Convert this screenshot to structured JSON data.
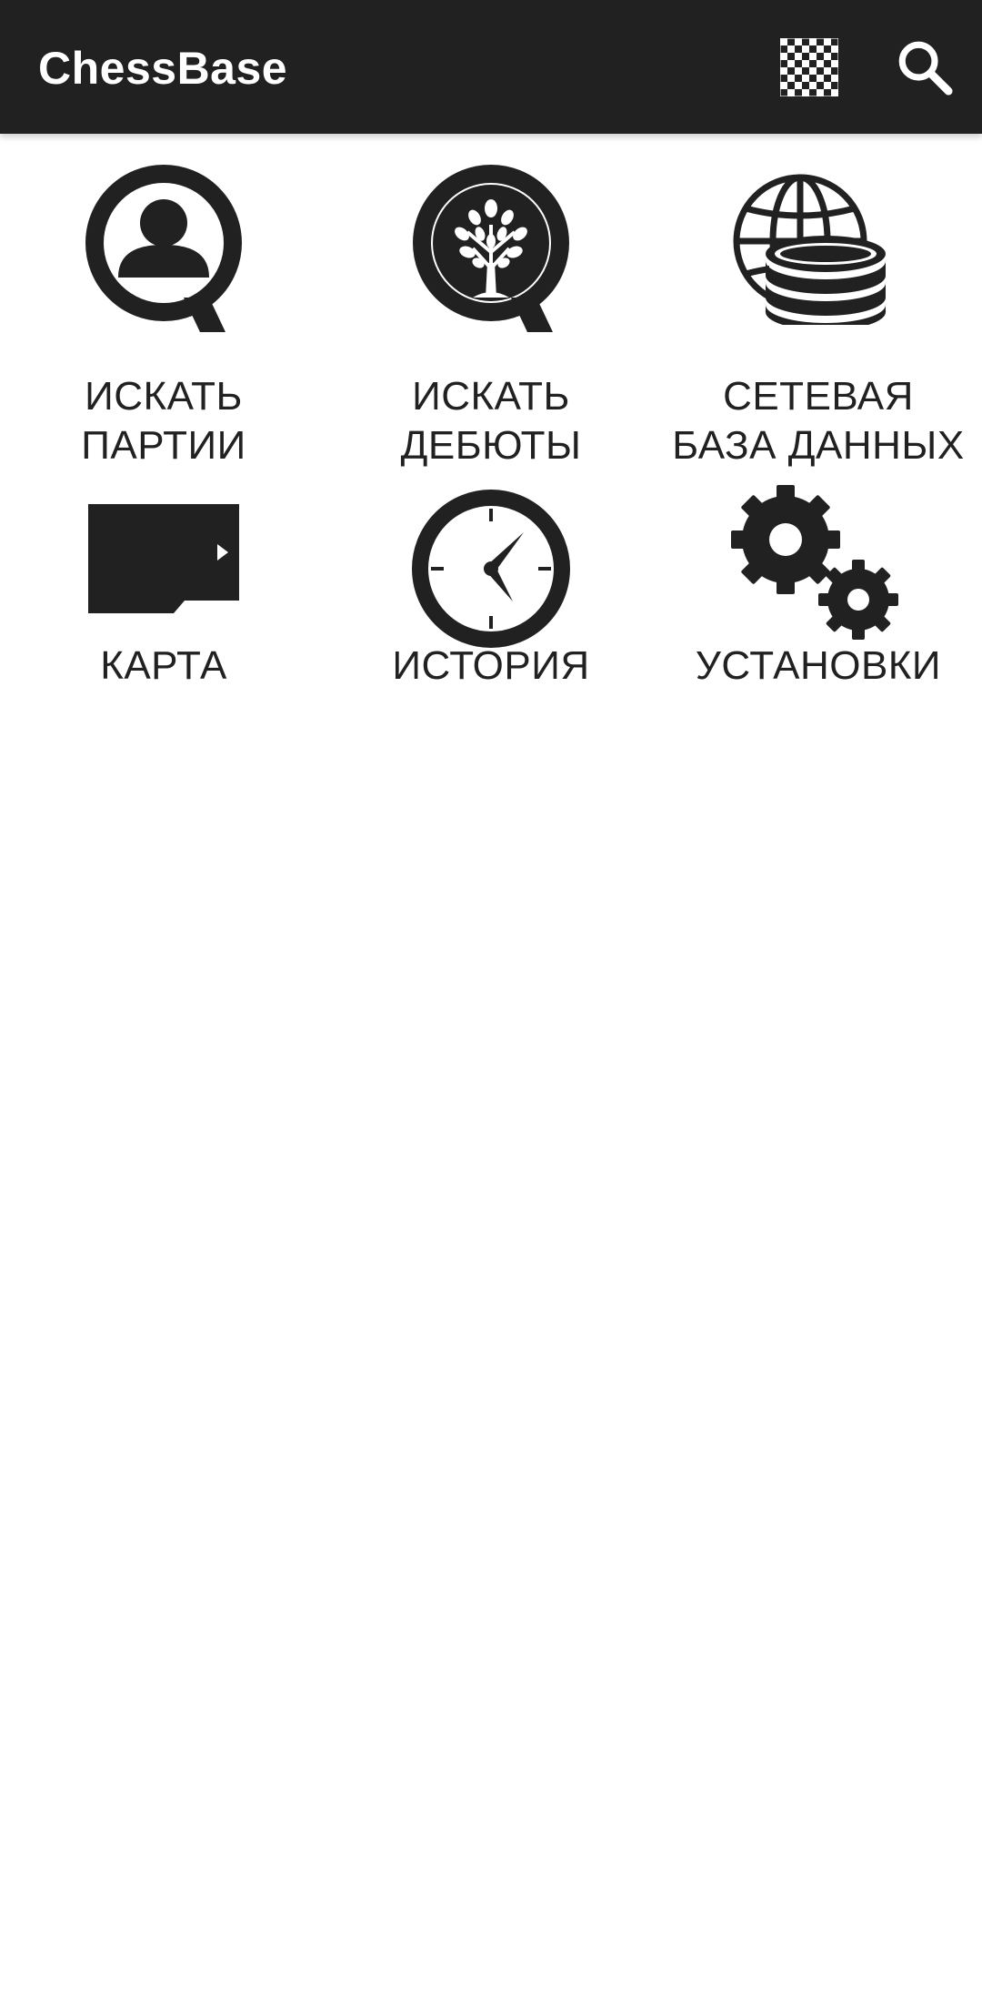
{
  "app_bar": {
    "title": "ChessBase",
    "actions": [
      {
        "name": "board",
        "icon": "chessboard-icon"
      },
      {
        "name": "search",
        "icon": "search-icon"
      }
    ]
  },
  "menu": {
    "items": [
      {
        "label": "ИСКАТЬ\nПАРТИИ",
        "icon": "search-games-icon"
      },
      {
        "label": "ИСКАТЬ\nДЕБЮТЫ",
        "icon": "search-openings-icon"
      },
      {
        "label": "СЕТЕВАЯ\nБАЗА ДАННЫХ",
        "icon": "online-database-icon"
      },
      {
        "label": "КАРТА",
        "icon": "sd-card-icon"
      },
      {
        "label": "ИСТОРИЯ",
        "icon": "clock-icon"
      },
      {
        "label": "УСТАНОВКИ",
        "icon": "gears-icon"
      }
    ]
  },
  "colors": {
    "app_bar": "#212121",
    "icon": "#212121",
    "background": "#ffffff"
  }
}
